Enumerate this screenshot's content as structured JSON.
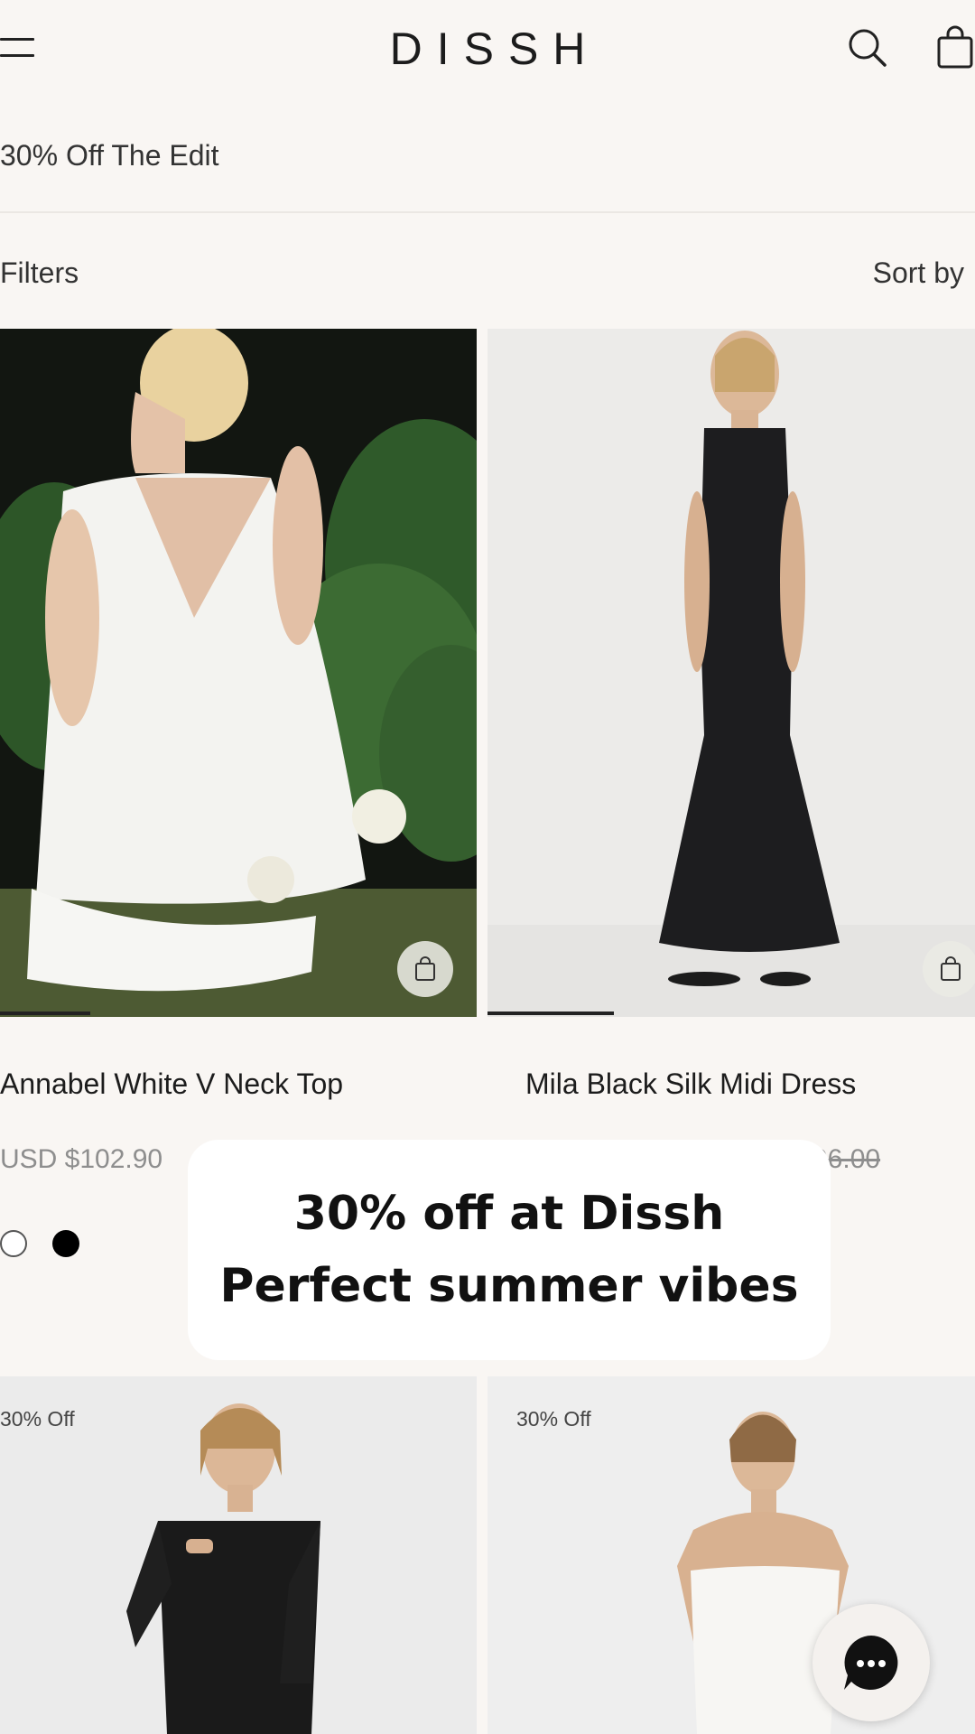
{
  "header": {
    "brand": "DISSH",
    "menu_icon": "hamburger-menu-icon",
    "search_icon": "search-icon",
    "bag_icon": "shopping-bag-icon"
  },
  "collection": {
    "breadcrumb": "30% Off The Edit",
    "filters_label": "Filters",
    "sort_label": "Sort by"
  },
  "products": [
    {
      "name": "Annabel White V Neck Top",
      "price": "USD $102.90",
      "swatches": [
        "white",
        "black"
      ],
      "image_progress": 0.19
    },
    {
      "name": "Mila Black Silk Midi Dress",
      "price_original_partial": "96.00",
      "image_progress": 0.26
    },
    {
      "badge": "30% Off"
    },
    {
      "badge": "30% Off"
    }
  ],
  "overlay": {
    "line1": "30% off at Dissh",
    "line2": "Perfect summer vibes"
  },
  "chat": {
    "icon": "chat-bubble-icon"
  },
  "colors": {
    "background": "#f9f6f3",
    "text": "#1c1c1c",
    "muted": "#8e8e8e",
    "overlay_bg": "#ffffff"
  }
}
